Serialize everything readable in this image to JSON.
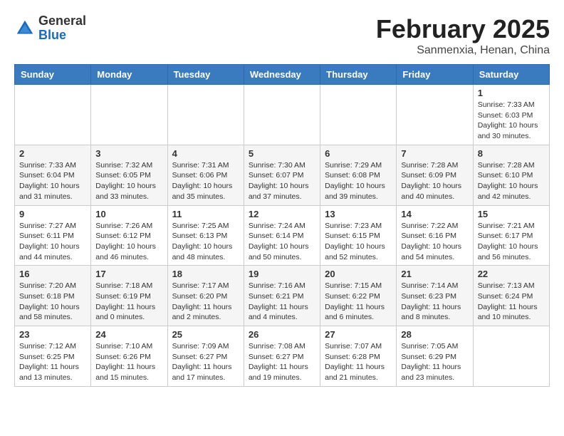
{
  "header": {
    "logo_general": "General",
    "logo_blue": "Blue",
    "month_year": "February 2025",
    "location": "Sanmenxia, Henan, China"
  },
  "days_of_week": [
    "Sunday",
    "Monday",
    "Tuesday",
    "Wednesday",
    "Thursday",
    "Friday",
    "Saturday"
  ],
  "weeks": [
    [
      {
        "day": "",
        "info": ""
      },
      {
        "day": "",
        "info": ""
      },
      {
        "day": "",
        "info": ""
      },
      {
        "day": "",
        "info": ""
      },
      {
        "day": "",
        "info": ""
      },
      {
        "day": "",
        "info": ""
      },
      {
        "day": "1",
        "info": "Sunrise: 7:33 AM\nSunset: 6:03 PM\nDaylight: 10 hours and 30 minutes."
      }
    ],
    [
      {
        "day": "2",
        "info": "Sunrise: 7:33 AM\nSunset: 6:04 PM\nDaylight: 10 hours and 31 minutes."
      },
      {
        "day": "3",
        "info": "Sunrise: 7:32 AM\nSunset: 6:05 PM\nDaylight: 10 hours and 33 minutes."
      },
      {
        "day": "4",
        "info": "Sunrise: 7:31 AM\nSunset: 6:06 PM\nDaylight: 10 hours and 35 minutes."
      },
      {
        "day": "5",
        "info": "Sunrise: 7:30 AM\nSunset: 6:07 PM\nDaylight: 10 hours and 37 minutes."
      },
      {
        "day": "6",
        "info": "Sunrise: 7:29 AM\nSunset: 6:08 PM\nDaylight: 10 hours and 39 minutes."
      },
      {
        "day": "7",
        "info": "Sunrise: 7:28 AM\nSunset: 6:09 PM\nDaylight: 10 hours and 40 minutes."
      },
      {
        "day": "8",
        "info": "Sunrise: 7:28 AM\nSunset: 6:10 PM\nDaylight: 10 hours and 42 minutes."
      }
    ],
    [
      {
        "day": "9",
        "info": "Sunrise: 7:27 AM\nSunset: 6:11 PM\nDaylight: 10 hours and 44 minutes."
      },
      {
        "day": "10",
        "info": "Sunrise: 7:26 AM\nSunset: 6:12 PM\nDaylight: 10 hours and 46 minutes."
      },
      {
        "day": "11",
        "info": "Sunrise: 7:25 AM\nSunset: 6:13 PM\nDaylight: 10 hours and 48 minutes."
      },
      {
        "day": "12",
        "info": "Sunrise: 7:24 AM\nSunset: 6:14 PM\nDaylight: 10 hours and 50 minutes."
      },
      {
        "day": "13",
        "info": "Sunrise: 7:23 AM\nSunset: 6:15 PM\nDaylight: 10 hours and 52 minutes."
      },
      {
        "day": "14",
        "info": "Sunrise: 7:22 AM\nSunset: 6:16 PM\nDaylight: 10 hours and 54 minutes."
      },
      {
        "day": "15",
        "info": "Sunrise: 7:21 AM\nSunset: 6:17 PM\nDaylight: 10 hours and 56 minutes."
      }
    ],
    [
      {
        "day": "16",
        "info": "Sunrise: 7:20 AM\nSunset: 6:18 PM\nDaylight: 10 hours and 58 minutes."
      },
      {
        "day": "17",
        "info": "Sunrise: 7:18 AM\nSunset: 6:19 PM\nDaylight: 11 hours and 0 minutes."
      },
      {
        "day": "18",
        "info": "Sunrise: 7:17 AM\nSunset: 6:20 PM\nDaylight: 11 hours and 2 minutes."
      },
      {
        "day": "19",
        "info": "Sunrise: 7:16 AM\nSunset: 6:21 PM\nDaylight: 11 hours and 4 minutes."
      },
      {
        "day": "20",
        "info": "Sunrise: 7:15 AM\nSunset: 6:22 PM\nDaylight: 11 hours and 6 minutes."
      },
      {
        "day": "21",
        "info": "Sunrise: 7:14 AM\nSunset: 6:23 PM\nDaylight: 11 hours and 8 minutes."
      },
      {
        "day": "22",
        "info": "Sunrise: 7:13 AM\nSunset: 6:24 PM\nDaylight: 11 hours and 10 minutes."
      }
    ],
    [
      {
        "day": "23",
        "info": "Sunrise: 7:12 AM\nSunset: 6:25 PM\nDaylight: 11 hours and 13 minutes."
      },
      {
        "day": "24",
        "info": "Sunrise: 7:10 AM\nSunset: 6:26 PM\nDaylight: 11 hours and 15 minutes."
      },
      {
        "day": "25",
        "info": "Sunrise: 7:09 AM\nSunset: 6:27 PM\nDaylight: 11 hours and 17 minutes."
      },
      {
        "day": "26",
        "info": "Sunrise: 7:08 AM\nSunset: 6:27 PM\nDaylight: 11 hours and 19 minutes."
      },
      {
        "day": "27",
        "info": "Sunrise: 7:07 AM\nSunset: 6:28 PM\nDaylight: 11 hours and 21 minutes."
      },
      {
        "day": "28",
        "info": "Sunrise: 7:05 AM\nSunset: 6:29 PM\nDaylight: 11 hours and 23 minutes."
      },
      {
        "day": "",
        "info": ""
      }
    ]
  ]
}
